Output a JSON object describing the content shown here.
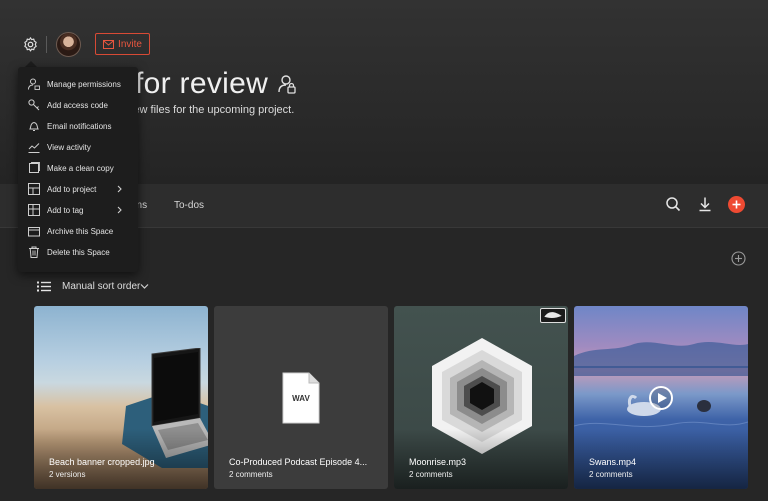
{
  "header": {
    "title": "for review",
    "subtitle": "iew files for the upcoming project.",
    "invite_label": "Invite"
  },
  "nav": {
    "tabs": [
      {
        "label": "ons"
      },
      {
        "label": "To-dos"
      }
    ]
  },
  "settings_menu": {
    "items": [
      {
        "label": "Manage permissions",
        "icon": "user-lock-icon"
      },
      {
        "label": "Add access code",
        "icon": "key-icon"
      },
      {
        "label": "Email notifications",
        "icon": "bell-icon"
      },
      {
        "label": "View activity",
        "icon": "activity-chart-icon"
      },
      {
        "label": "Make a clean copy",
        "icon": "copy-icon"
      },
      {
        "label": "Add to project",
        "icon": "project-icon",
        "submenu": true
      },
      {
        "label": "Add to tag",
        "icon": "tag-board-icon",
        "submenu": true
      },
      {
        "label": "Archive this Space",
        "icon": "archive-icon"
      },
      {
        "label": "Delete this Space",
        "icon": "trash-icon"
      }
    ]
  },
  "sort": {
    "label": "Manual sort order"
  },
  "files": [
    {
      "name": "Beach banner cropped.jpg",
      "meta": "2 versions"
    },
    {
      "name": "Co-Produced Podcast Episode 4...",
      "meta": "2 comments",
      "type_label": "WAV"
    },
    {
      "name": "Moonrise.mp3",
      "meta": "2 comments"
    },
    {
      "name": "Swans.mp4",
      "meta": "2 comments"
    }
  ],
  "colors": {
    "accent": "#ee4a32",
    "background": "#262626",
    "menu_background": "#1d1d1d"
  }
}
